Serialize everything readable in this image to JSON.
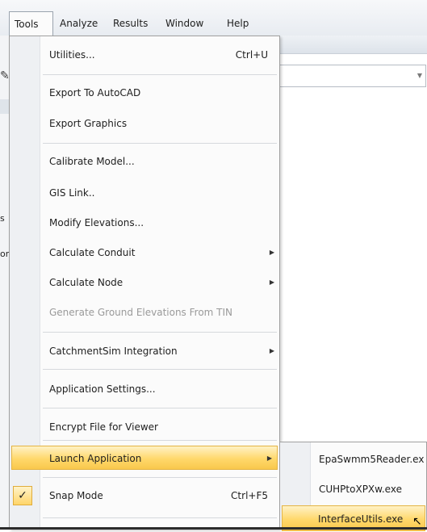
{
  "menubar": {
    "items": [
      {
        "label": "Tools"
      },
      {
        "label": "Analyze"
      },
      {
        "label": "Results"
      },
      {
        "label": "Window"
      },
      {
        "label": "Help"
      }
    ]
  },
  "background": {
    "left_fragments": [
      "s",
      "on"
    ]
  },
  "tools_menu": {
    "utilities": {
      "label": "Utilities...",
      "shortcut": "Ctrl+U"
    },
    "export_autocad": {
      "label": "Export To AutoCAD"
    },
    "export_graphics": {
      "label": "Export Graphics"
    },
    "calibrate_model": {
      "label": "Calibrate Model..."
    },
    "gis_link": {
      "label": "GIS Link.."
    },
    "modify_elevations": {
      "label": "Modify Elevations..."
    },
    "calculate_conduit": {
      "label": "Calculate Conduit"
    },
    "calculate_node": {
      "label": "Calculate Node"
    },
    "generate_ground": {
      "label": "Generate Ground Elevations From TIN"
    },
    "catchmentsim": {
      "label": "CatchmentSim Integration"
    },
    "app_settings": {
      "label": "Application Settings..."
    },
    "encrypt_file": {
      "label": "Encrypt File for Viewer"
    },
    "launch_app": {
      "label": "Launch Application"
    },
    "snap_mode": {
      "label": "Snap Mode",
      "shortcut": "Ctrl+F5",
      "check": "✓"
    }
  },
  "launch_submenu": {
    "items": [
      {
        "label": "EpaSwmm5Reader.ex"
      },
      {
        "label": "CUHPtoXPXw.exe"
      },
      {
        "label": "InterfaceUtils.exe"
      }
    ]
  },
  "icons": {
    "submenu_arrow": "▶",
    "combo_arrow": "▼",
    "pen": "✎",
    "cursor": "↖"
  }
}
